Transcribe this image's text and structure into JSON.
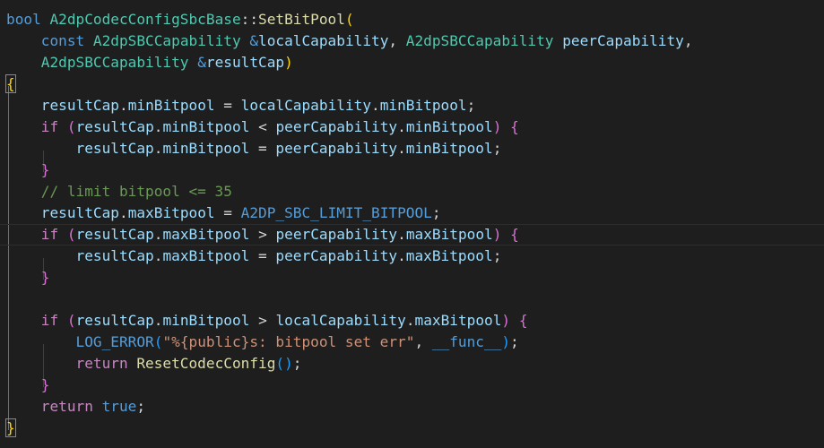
{
  "editor": {
    "lines": [
      [
        {
          "t": "bool",
          "c": "kw"
        },
        {
          "t": " ",
          "c": "plain"
        },
        {
          "t": "A2dpCodecConfigSbcBase",
          "c": "type"
        },
        {
          "t": "::",
          "c": "plain"
        },
        {
          "t": "SetBitPool",
          "c": "fn"
        },
        {
          "t": "(",
          "c": "p1"
        }
      ],
      [
        {
          "t": "    ",
          "c": "plain"
        },
        {
          "t": "const",
          "c": "kw"
        },
        {
          "t": " ",
          "c": "plain"
        },
        {
          "t": "A2dpSBCCapability",
          "c": "type"
        },
        {
          "t": " ",
          "c": "plain"
        },
        {
          "t": "&",
          "c": "kw"
        },
        {
          "t": "localCapability",
          "c": "var"
        },
        {
          "t": ", ",
          "c": "plain"
        },
        {
          "t": "A2dpSBCCapability",
          "c": "type"
        },
        {
          "t": " ",
          "c": "plain"
        },
        {
          "t": "peerCapability",
          "c": "var"
        },
        {
          "t": ",",
          "c": "plain"
        }
      ],
      [
        {
          "t": "    ",
          "c": "plain"
        },
        {
          "t": "A2dpSBCCapability",
          "c": "type"
        },
        {
          "t": " ",
          "c": "plain"
        },
        {
          "t": "&",
          "c": "kw"
        },
        {
          "t": "resultCap",
          "c": "var"
        },
        {
          "t": ")",
          "c": "p1"
        }
      ],
      [
        {
          "t": "{",
          "c": "p1 brace-m"
        }
      ],
      [
        {
          "t": "    ",
          "c": "plain"
        },
        {
          "t": "resultCap",
          "c": "var"
        },
        {
          "t": ".",
          "c": "plain"
        },
        {
          "t": "minBitpool",
          "c": "var"
        },
        {
          "t": " = ",
          "c": "plain"
        },
        {
          "t": "localCapability",
          "c": "var"
        },
        {
          "t": ".",
          "c": "plain"
        },
        {
          "t": "minBitpool",
          "c": "var"
        },
        {
          "t": ";",
          "c": "plain"
        }
      ],
      [
        {
          "t": "    ",
          "c": "plain"
        },
        {
          "t": "if",
          "c": "ctrl"
        },
        {
          "t": " ",
          "c": "plain"
        },
        {
          "t": "(",
          "c": "p2"
        },
        {
          "t": "resultCap",
          "c": "var"
        },
        {
          "t": ".",
          "c": "plain"
        },
        {
          "t": "minBitpool",
          "c": "var"
        },
        {
          "t": " < ",
          "c": "plain"
        },
        {
          "t": "peerCapability",
          "c": "var"
        },
        {
          "t": ".",
          "c": "plain"
        },
        {
          "t": "minBitpool",
          "c": "var"
        },
        {
          "t": ")",
          "c": "p2"
        },
        {
          "t": " ",
          "c": "plain"
        },
        {
          "t": "{",
          "c": "p2"
        }
      ],
      [
        {
          "t": "        ",
          "c": "plain"
        },
        {
          "t": "resultCap",
          "c": "var"
        },
        {
          "t": ".",
          "c": "plain"
        },
        {
          "t": "minBitpool",
          "c": "var"
        },
        {
          "t": " = ",
          "c": "plain"
        },
        {
          "t": "peerCapability",
          "c": "var"
        },
        {
          "t": ".",
          "c": "plain"
        },
        {
          "t": "minBitpool",
          "c": "var"
        },
        {
          "t": ";",
          "c": "plain"
        }
      ],
      [
        {
          "t": "    ",
          "c": "plain"
        },
        {
          "t": "}",
          "c": "p2"
        }
      ],
      [
        {
          "t": "    ",
          "c": "plain"
        },
        {
          "t": "// limit bitpool <= 35",
          "c": "cmt"
        }
      ],
      [
        {
          "t": "    ",
          "c": "plain"
        },
        {
          "t": "resultCap",
          "c": "var"
        },
        {
          "t": ".",
          "c": "plain"
        },
        {
          "t": "maxBitpool",
          "c": "var"
        },
        {
          "t": " = ",
          "c": "plain"
        },
        {
          "t": "A2DP_SBC_LIMIT_BITPOOL",
          "c": "macro"
        },
        {
          "t": ";",
          "c": "plain"
        }
      ],
      [
        {
          "t": "    ",
          "c": "plain"
        },
        {
          "t": "if",
          "c": "ctrl"
        },
        {
          "t": " ",
          "c": "plain"
        },
        {
          "t": "(",
          "c": "p2"
        },
        {
          "t": "resultCap",
          "c": "var"
        },
        {
          "t": ".",
          "c": "plain"
        },
        {
          "t": "maxBitpool",
          "c": "var"
        },
        {
          "t": " > ",
          "c": "plain"
        },
        {
          "t": "peerCapability",
          "c": "var"
        },
        {
          "t": ".",
          "c": "plain"
        },
        {
          "t": "maxBitpool",
          "c": "var"
        },
        {
          "t": ")",
          "c": "p2"
        },
        {
          "t": " ",
          "c": "plain"
        },
        {
          "t": "{",
          "c": "p2"
        }
      ],
      [
        {
          "t": "        ",
          "c": "plain"
        },
        {
          "t": "resultCap",
          "c": "var"
        },
        {
          "t": ".",
          "c": "plain"
        },
        {
          "t": "maxBitpool",
          "c": "var"
        },
        {
          "t": " = ",
          "c": "plain"
        },
        {
          "t": "peerCapability",
          "c": "var"
        },
        {
          "t": ".",
          "c": "plain"
        },
        {
          "t": "maxBitpool",
          "c": "var"
        },
        {
          "t": ";",
          "c": "plain"
        }
      ],
      [
        {
          "t": "    ",
          "c": "plain"
        },
        {
          "t": "}",
          "c": "p2"
        }
      ],
      [],
      [
        {
          "t": "    ",
          "c": "plain"
        },
        {
          "t": "if",
          "c": "ctrl"
        },
        {
          "t": " ",
          "c": "plain"
        },
        {
          "t": "(",
          "c": "p2"
        },
        {
          "t": "resultCap",
          "c": "var"
        },
        {
          "t": ".",
          "c": "plain"
        },
        {
          "t": "minBitpool",
          "c": "var"
        },
        {
          "t": " > ",
          "c": "plain"
        },
        {
          "t": "localCapability",
          "c": "var"
        },
        {
          "t": ".",
          "c": "plain"
        },
        {
          "t": "maxBitpool",
          "c": "var"
        },
        {
          "t": ")",
          "c": "p2"
        },
        {
          "t": " ",
          "c": "plain"
        },
        {
          "t": "{",
          "c": "p2"
        }
      ],
      [
        {
          "t": "        ",
          "c": "plain"
        },
        {
          "t": "LOG_ERROR",
          "c": "macro"
        },
        {
          "t": "(",
          "c": "p3"
        },
        {
          "t": "\"%{public}s: bitpool set err\"",
          "c": "str"
        },
        {
          "t": ", ",
          "c": "plain"
        },
        {
          "t": "__func__",
          "c": "macro"
        },
        {
          "t": ")",
          "c": "p3"
        },
        {
          "t": ";",
          "c": "plain"
        }
      ],
      [
        {
          "t": "        ",
          "c": "plain"
        },
        {
          "t": "return",
          "c": "ctrl"
        },
        {
          "t": " ",
          "c": "plain"
        },
        {
          "t": "ResetCodecConfig",
          "c": "fn"
        },
        {
          "t": "(",
          "c": "p3"
        },
        {
          "t": ")",
          "c": "p3"
        },
        {
          "t": ";",
          "c": "plain"
        }
      ],
      [
        {
          "t": "    ",
          "c": "plain"
        },
        {
          "t": "}",
          "c": "p2"
        }
      ],
      [
        {
          "t": "    ",
          "c": "plain"
        },
        {
          "t": "return",
          "c": "ctrl"
        },
        {
          "t": " ",
          "c": "plain"
        },
        {
          "t": "true",
          "c": "kw"
        },
        {
          "t": ";",
          "c": "plain"
        }
      ],
      [
        {
          "t": "}",
          "c": "p1 brace-m"
        }
      ]
    ]
  }
}
